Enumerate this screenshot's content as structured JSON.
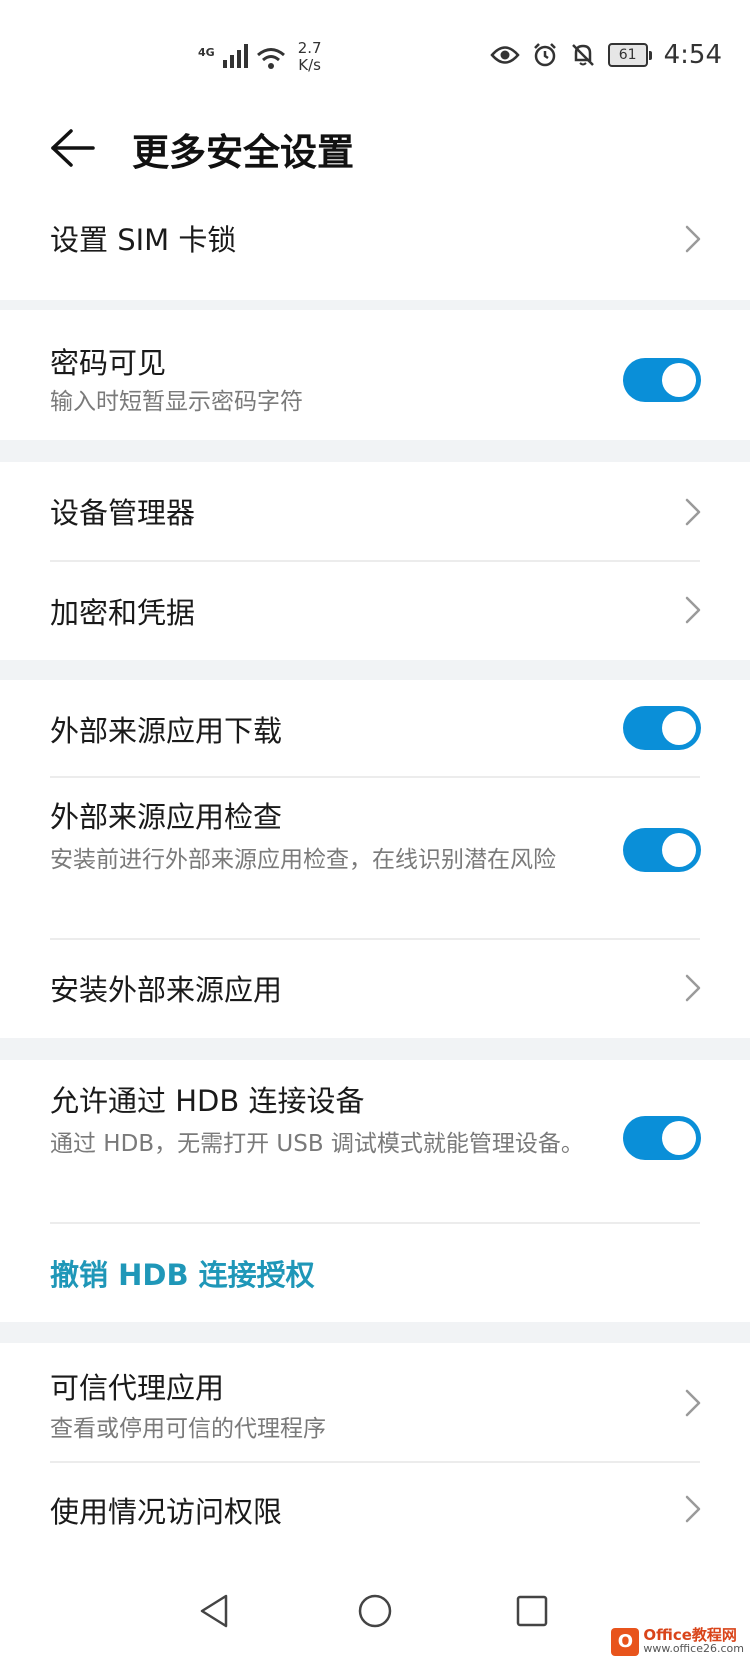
{
  "status_bar": {
    "network_type": "4G",
    "speed_value": "2.7",
    "speed_unit": "K/s",
    "battery_level": "61",
    "time": "4:54"
  },
  "header": {
    "title": "更多安全设置"
  },
  "sections": {
    "sim_lock": {
      "title": "设置 SIM 卡锁"
    },
    "password_visible": {
      "title": "密码可见",
      "subtitle": "输入时短暂显示密码字符",
      "enabled": true
    },
    "device_manager": {
      "title": "设备管理器"
    },
    "encryption": {
      "title": "加密和凭据"
    },
    "external_download": {
      "title": "外部来源应用下载",
      "enabled": true
    },
    "external_check": {
      "title": "外部来源应用检查",
      "subtitle": "安装前进行外部来源应用检查，在线识别潜在风险",
      "enabled": true
    },
    "install_external": {
      "title": "安装外部来源应用"
    },
    "hdb_connect": {
      "title": "允许通过 HDB 连接设备",
      "subtitle": "通过 HDB，无需打开 USB 调试模式就能管理设备。",
      "enabled": true
    },
    "revoke_hdb": {
      "title": "撤销 HDB 连接授权"
    },
    "trust_agents": {
      "title": "可信代理应用",
      "subtitle": "查看或停用可信的代理程序"
    },
    "usage_access": {
      "title": "使用情况访问权限"
    }
  },
  "colors": {
    "accent": "#0a8fd8",
    "link": "#1f97b8",
    "background": "#f1f3f5"
  },
  "watermark": {
    "logo": "O",
    "main": "Office教程网",
    "url": "www.office26.com"
  }
}
